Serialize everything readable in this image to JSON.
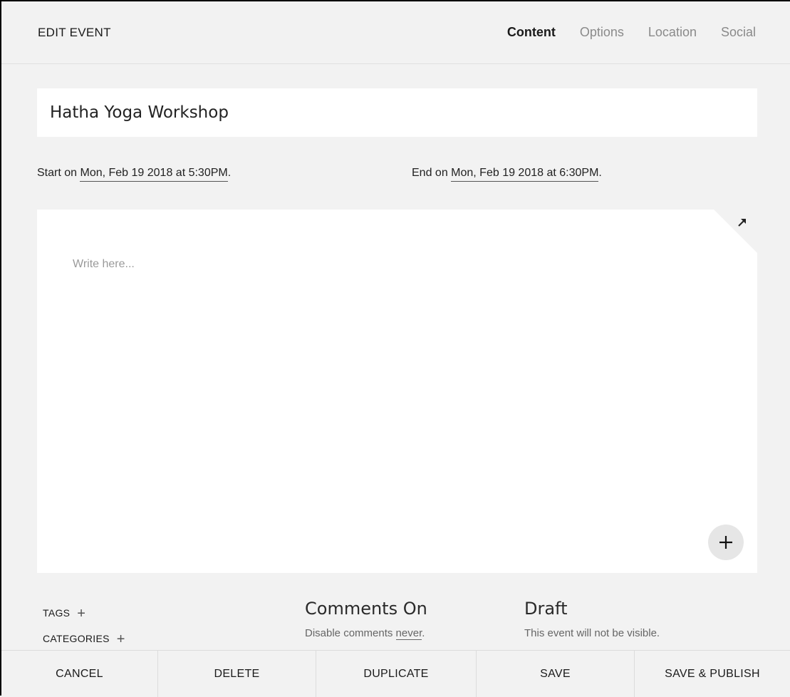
{
  "header": {
    "title": "EDIT EVENT",
    "tabs": [
      {
        "label": "Content",
        "active": true
      },
      {
        "label": "Options",
        "active": false
      },
      {
        "label": "Location",
        "active": false
      },
      {
        "label": "Social",
        "active": false
      }
    ]
  },
  "event": {
    "title_value": "Hatha Yoga Workshop",
    "start_prefix": "Start on ",
    "start_value": "Mon, Feb 19 2018 at 5:30PM",
    "end_prefix": "End on ",
    "end_value": "Mon, Feb 19 2018 at 6:30PM",
    "period": "."
  },
  "editor": {
    "placeholder": "Write here...",
    "expand_icon": "expand-arrow-icon",
    "add_icon": "plus-icon"
  },
  "meta": {
    "tags_label": "TAGS",
    "categories_label": "CATEGORIES",
    "plus_glyph": "+",
    "comments_title": "Comments On",
    "comments_prefix": "Disable comments ",
    "comments_link": "never",
    "status_title": "Draft",
    "status_desc": "This event will not be visible."
  },
  "footer": {
    "cancel": "CANCEL",
    "delete": "DELETE",
    "duplicate": "DUPLICATE",
    "save": "SAVE",
    "save_publish": "SAVE & PUBLISH"
  }
}
